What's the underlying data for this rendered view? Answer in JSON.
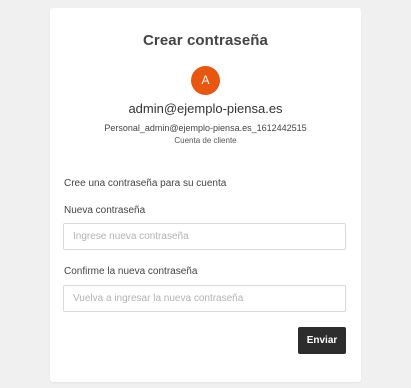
{
  "form": {
    "title": "Crear contraseña",
    "avatar_initial": "A",
    "avatar_color": "#e8560f",
    "email": "admin@ejemplo-piensa.es",
    "username": "Personal_admin@ejemplo-piensa.es_1612442515",
    "account_type": "Cuenta de cliente",
    "intro": "Cree una contraseña para su cuenta",
    "new_password": {
      "label": "Nueva contraseña",
      "value": "",
      "placeholder": "Ingrese nueva contraseña"
    },
    "confirm_password": {
      "label": "Confirme la nueva contraseña",
      "value": "",
      "placeholder": "Vuelva a ingresar la nueva contraseña"
    },
    "submit_label": "Enviar",
    "submit_color": "#2d2d2d"
  }
}
